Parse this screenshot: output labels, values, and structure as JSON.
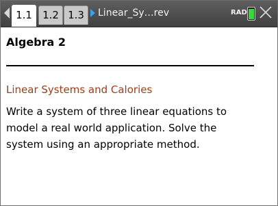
{
  "tabs": [
    {
      "label": "1.1",
      "active": true
    },
    {
      "label": "1.2",
      "active": false
    },
    {
      "label": "1.3",
      "active": false
    }
  ],
  "document_title": "Linear_Sy…rev",
  "angle_mode": "RAD",
  "icons": {
    "back": "left-arrow-icon",
    "doc": "right-triangle-icon",
    "battery": "battery-icon",
    "close": "close-icon"
  },
  "colors": {
    "accent_blue": "#3aa2e8",
    "subtitle": "#a03c18",
    "battery": "#3ed63e"
  },
  "page": {
    "heading": "Algebra 2",
    "subtitle": "Linear Systems and Calories",
    "body_lines": [
      "Write a system of three linear equations to",
      "model a real world application.  Solve the",
      "system using an appropriate method."
    ]
  }
}
